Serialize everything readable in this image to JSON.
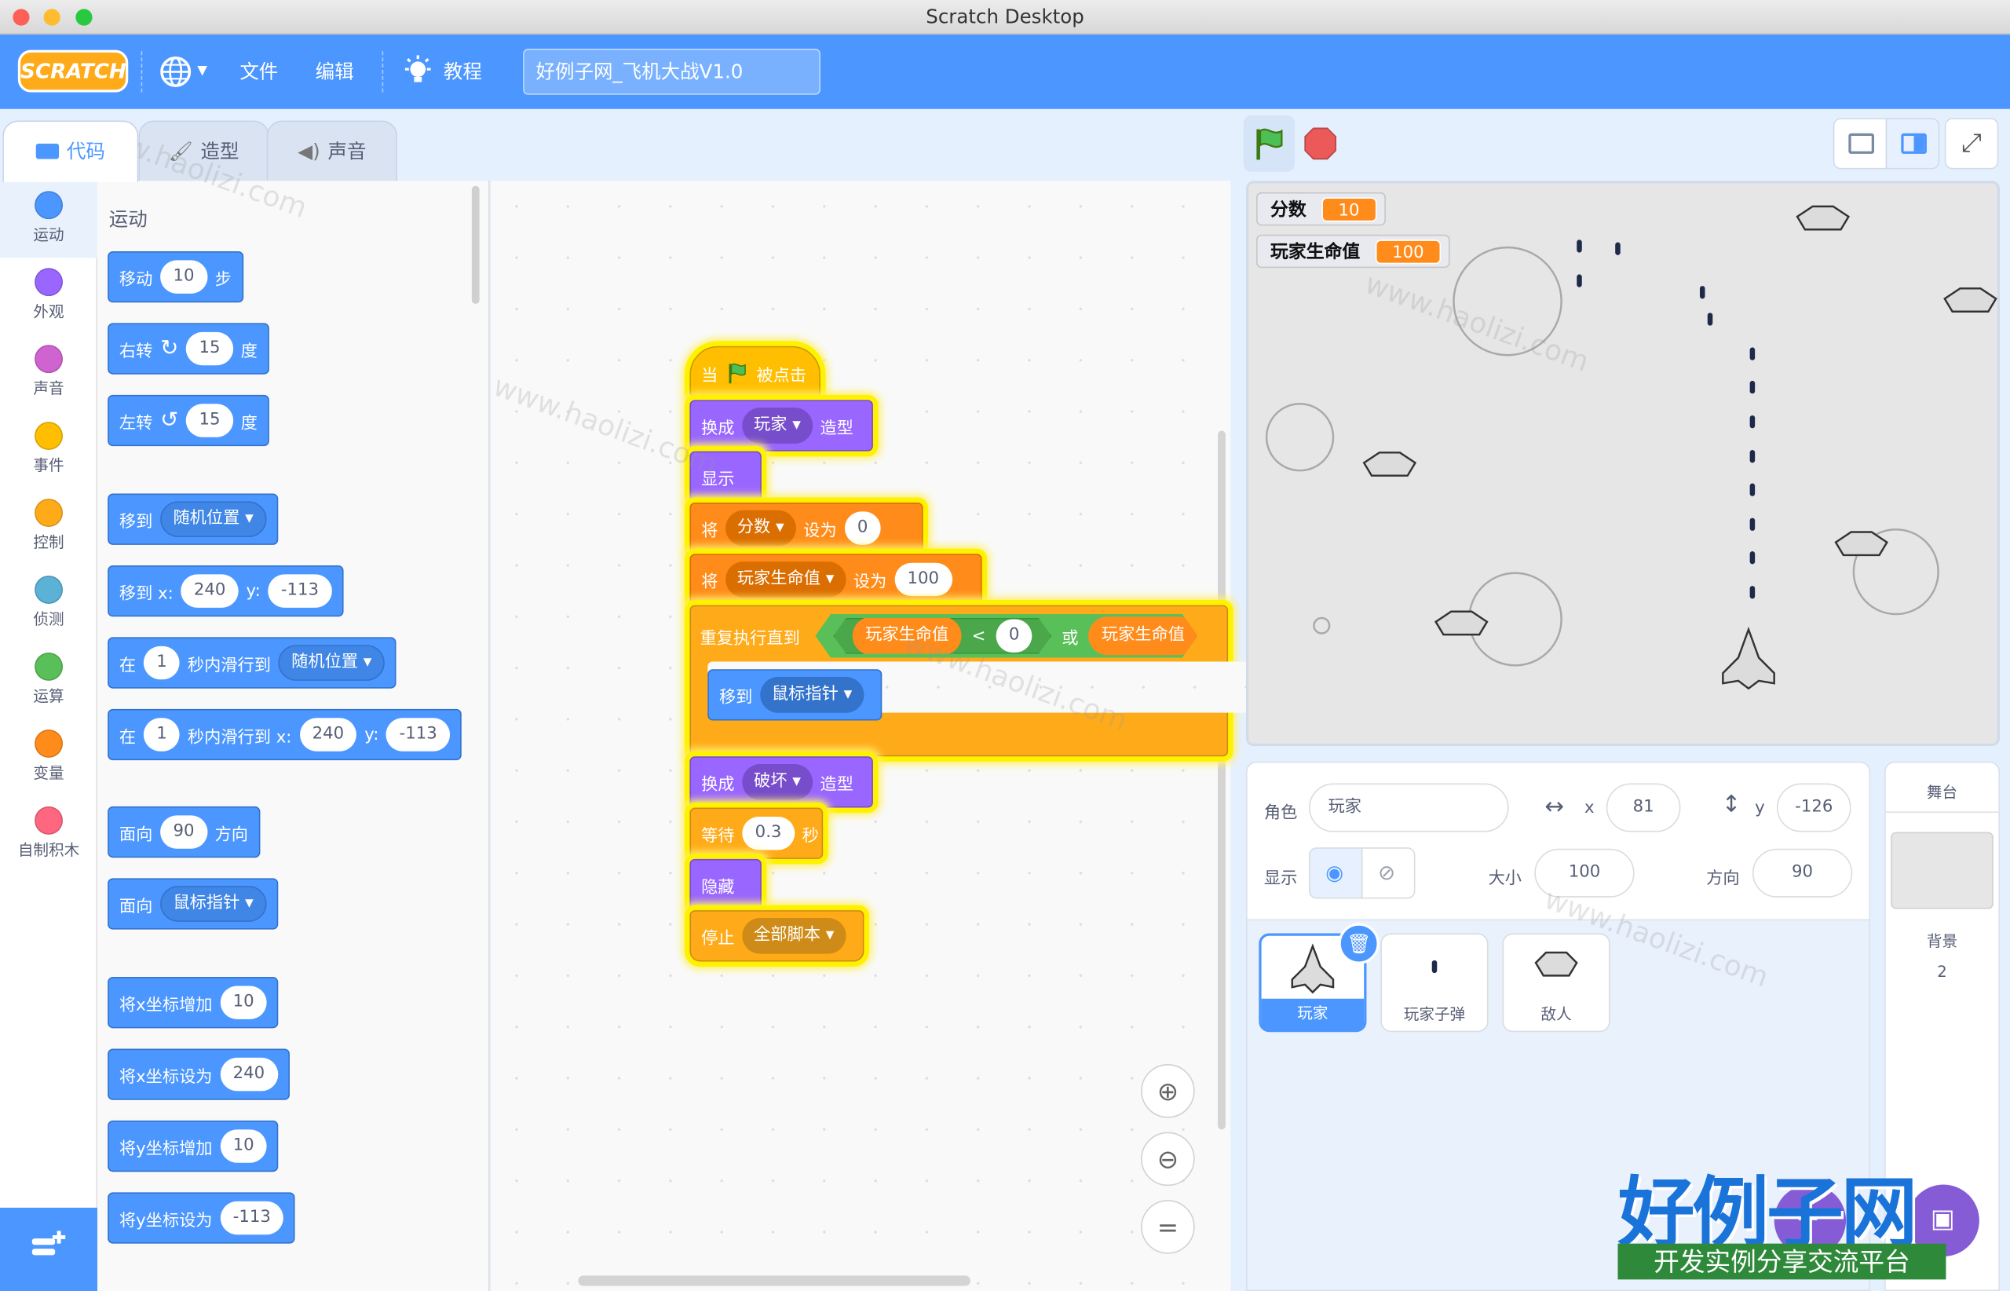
{
  "window": {
    "title": "Scratch Desktop"
  },
  "menu": {
    "logo": "SCRATCH",
    "file": "文件",
    "edit": "编辑",
    "tutorials": "教程",
    "project_title": "好例子网_飞机大战V1.0"
  },
  "tabs": [
    {
      "label": "代码"
    },
    {
      "label": "造型"
    },
    {
      "label": "声音"
    }
  ],
  "categories": [
    {
      "label": "运动",
      "color": "#4c97ff"
    },
    {
      "label": "外观",
      "color": "#9966ff"
    },
    {
      "label": "声音",
      "color": "#cf63cf"
    },
    {
      "label": "事件",
      "color": "#ffbf00"
    },
    {
      "label": "控制",
      "color": "#ffab19"
    },
    {
      "label": "侦测",
      "color": "#5cb1d6"
    },
    {
      "label": "运算",
      "color": "#59c059"
    },
    {
      "label": "变量",
      "color": "#ff8c1a"
    },
    {
      "label": "自制积木",
      "color": "#ff6680"
    }
  ],
  "palette": {
    "section_title": "运动",
    "move": {
      "a": "移动",
      "v": "10",
      "b": "步"
    },
    "turn_right": {
      "a": "右转",
      "v": "15",
      "b": "度"
    },
    "turn_left": {
      "a": "左转",
      "v": "15",
      "b": "度"
    },
    "goto": {
      "a": "移到",
      "dd": "随机位置"
    },
    "goto_xy": {
      "a": "移到 x:",
      "x": "240",
      "b": "y:",
      "y": "-113"
    },
    "glide": {
      "a": "在",
      "v": "1",
      "b": "秒内滑行到",
      "dd": "随机位置"
    },
    "glide_xy": {
      "a": "在",
      "v": "1",
      "b": "秒内滑行到 x:",
      "x": "240",
      "c": "y:",
      "y": "-113"
    },
    "point_dir": {
      "a": "面向",
      "v": "90",
      "b": "方向"
    },
    "point_to": {
      "a": "面向",
      "dd": "鼠标指针"
    },
    "change_x": {
      "a": "将x坐标增加",
      "v": "10"
    },
    "set_x": {
      "a": "将x坐标设为",
      "v": "240"
    },
    "change_y": {
      "a": "将y坐标增加",
      "v": "10"
    },
    "set_y": {
      "a": "将y坐标设为",
      "v": "-113"
    }
  },
  "script": {
    "hat": {
      "a": "当",
      "b": "被点击"
    },
    "switch1": {
      "a": "换成",
      "dd": "玩家",
      "b": "造型"
    },
    "show": "显示",
    "set_score": {
      "a": "将",
      "dd": "分数",
      "b": "设为",
      "v": "0"
    },
    "set_hp": {
      "a": "将",
      "dd": "玩家生命值",
      "b": "设为",
      "v": "100"
    },
    "repeat": {
      "a": "重复执行直到",
      "r1": "玩家生命值",
      "op": "<",
      "v": "0",
      "or": "或",
      "r2": "玩家生命值"
    },
    "goto": {
      "a": "移到",
      "dd": "鼠标指针"
    },
    "switch2": {
      "a": "换成",
      "dd": "破坏",
      "b": "造型"
    },
    "wait": {
      "a": "等待",
      "v": "0.3",
      "b": "秒"
    },
    "hide": "隐藏",
    "stop": {
      "a": "停止",
      "dd": "全部脚本"
    }
  },
  "stage": {
    "monitors": [
      {
        "label": "分数",
        "value": "10"
      },
      {
        "label": "玩家生命值",
        "value": "100"
      }
    ]
  },
  "sprite_info": {
    "sprite_label": "角色",
    "sprite_name": "玩家",
    "x_label": "x",
    "x": "81",
    "y_label": "y",
    "y": "-126",
    "show_label": "显示",
    "size_label": "大小",
    "size": "100",
    "direction_label": "方向",
    "direction": "90"
  },
  "sprites": [
    {
      "name": "玩家"
    },
    {
      "name": "玩家子弹"
    },
    {
      "name": "敌人"
    }
  ],
  "stage_panel": {
    "title": "舞台",
    "backdrop_label": "背景",
    "backdrop_count": "2"
  },
  "watermark": {
    "text": "www.haolizi.com",
    "brand": "好例子网",
    "brand_sub": "开发实例分享交流平台"
  }
}
